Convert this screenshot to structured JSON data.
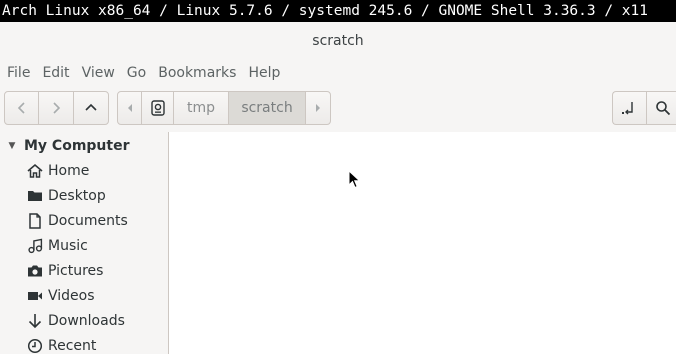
{
  "topbar": {
    "text": "Arch Linux x86_64 / Linux 5.7.6 / systemd 245.6 / GNOME Shell 3.36.3 / x11"
  },
  "window": {
    "title": "scratch"
  },
  "menu": {
    "file": "File",
    "edit": "Edit",
    "view": "View",
    "go": "Go",
    "bookmarks": "Bookmarks",
    "help": "Help"
  },
  "toolbar": {
    "back_icon": "chevron-left-icon",
    "forward_icon": "chevron-right-icon",
    "up_icon": "chevron-up-icon",
    "path": [
      {
        "label": "tmp"
      },
      {
        "label": "scratch"
      }
    ],
    "open_terminal_icon": "terminal-icon",
    "search_icon": "search-icon"
  },
  "sidebar": {
    "section_title": "My Computer",
    "items": [
      {
        "label": "Home",
        "icon": "home-icon"
      },
      {
        "label": "Desktop",
        "icon": "folder-icon"
      },
      {
        "label": "Documents",
        "icon": "document-icon"
      },
      {
        "label": "Music",
        "icon": "music-icon"
      },
      {
        "label": "Pictures",
        "icon": "camera-icon"
      },
      {
        "label": "Videos",
        "icon": "video-icon"
      },
      {
        "label": "Downloads",
        "icon": "download-icon"
      },
      {
        "label": "Recent",
        "icon": "clock-icon"
      }
    ]
  }
}
